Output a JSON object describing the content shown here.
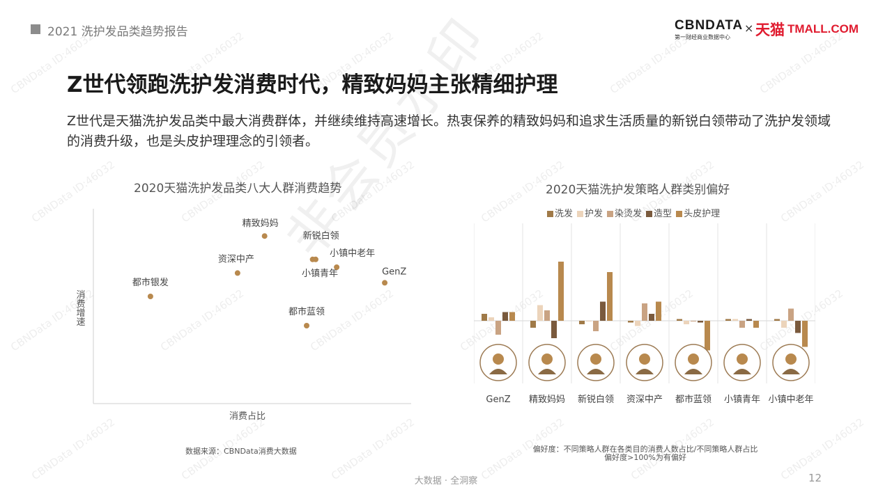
{
  "header": {
    "report_title": "2021 洗护发品类趋势报告"
  },
  "logo": {
    "cbn": "CBNDATA",
    "cbn_sub": "第一财经商业数据中心",
    "times": "×",
    "tmall_cn": "天猫",
    "tmall_en": "TMALL.COM"
  },
  "page": {
    "title": "Z世代领跑洗护发消费时代，精致妈妈主张精细护理",
    "desc": "Z世代是天猫洗护发品类中最大消费群体，并继续维持高速增长。热衷保养的精致妈妈和追求生活质量的新锐白领带动了洗护发领域的消费升级，也是头皮护理理念的引领者。"
  },
  "watermark": {
    "big": "非会员水印",
    "small": "CBNData ID:46032"
  },
  "chart_data": [
    {
      "type": "scatter",
      "title": "2020天猫洗护发品类八大人群消费趋势",
      "xlabel": "消费占比",
      "ylabel": "消费增速",
      "xlim": [
        0,
        100
      ],
      "ylim": [
        0,
        100
      ],
      "color": "#b8894e",
      "points": [
        {
          "label": "精致妈妈",
          "x": 57,
          "y": 86
        },
        {
          "label": "新锐白领",
          "x": 73,
          "y": 74
        },
        {
          "label": "小镇青年",
          "x": 74,
          "y": 74
        },
        {
          "label": "小镇中老年",
          "x": 81,
          "y": 70
        },
        {
          "label": "资深中产",
          "x": 48,
          "y": 67
        },
        {
          "label": "GenZ",
          "x": 97,
          "y": 62
        },
        {
          "label": "都市银发",
          "x": 19,
          "y": 55
        },
        {
          "label": "都市蓝领",
          "x": 71,
          "y": 40
        }
      ],
      "source": "数据来源：CBNData消费大数据"
    },
    {
      "type": "bar",
      "title": "2020天猫洗护发策略人群类别偏好",
      "categories": [
        "GenZ",
        "精致妈妈",
        "新锐白领",
        "资深中产",
        "都市蓝领",
        "小镇青年",
        "小镇中老年"
      ],
      "series": [
        {
          "name": "洗发",
          "color": "#a07a48",
          "values": [
            4,
            -4,
            -2,
            -1,
            1,
            1,
            1
          ]
        },
        {
          "name": "护发",
          "color": "#ecd4bb",
          "values": [
            2,
            9,
            0,
            -3,
            -2,
            1,
            -4
          ]
        },
        {
          "name": "染烫发",
          "color": "#c9a383",
          "values": [
            -8,
            6,
            -6,
            10,
            0,
            -4,
            7
          ]
        },
        {
          "name": "造型",
          "color": "#7a5a3d",
          "values": [
            5,
            -10,
            11,
            4,
            -1,
            1,
            -7
          ]
        },
        {
          "name": "头皮护理",
          "color": "#b8894e",
          "values": [
            5,
            34,
            28,
            11,
            -17,
            -4,
            -15
          ]
        }
      ],
      "ylim": [
        -20,
        36
      ],
      "note": [
        "偏好度：不同策略人群在各类目的消费人数占比/不同策略人群占比",
        "偏好度>100%为有偏好"
      ]
    }
  ],
  "footer": {
    "center": "大数据 · 全洞察",
    "page_number": "12"
  }
}
